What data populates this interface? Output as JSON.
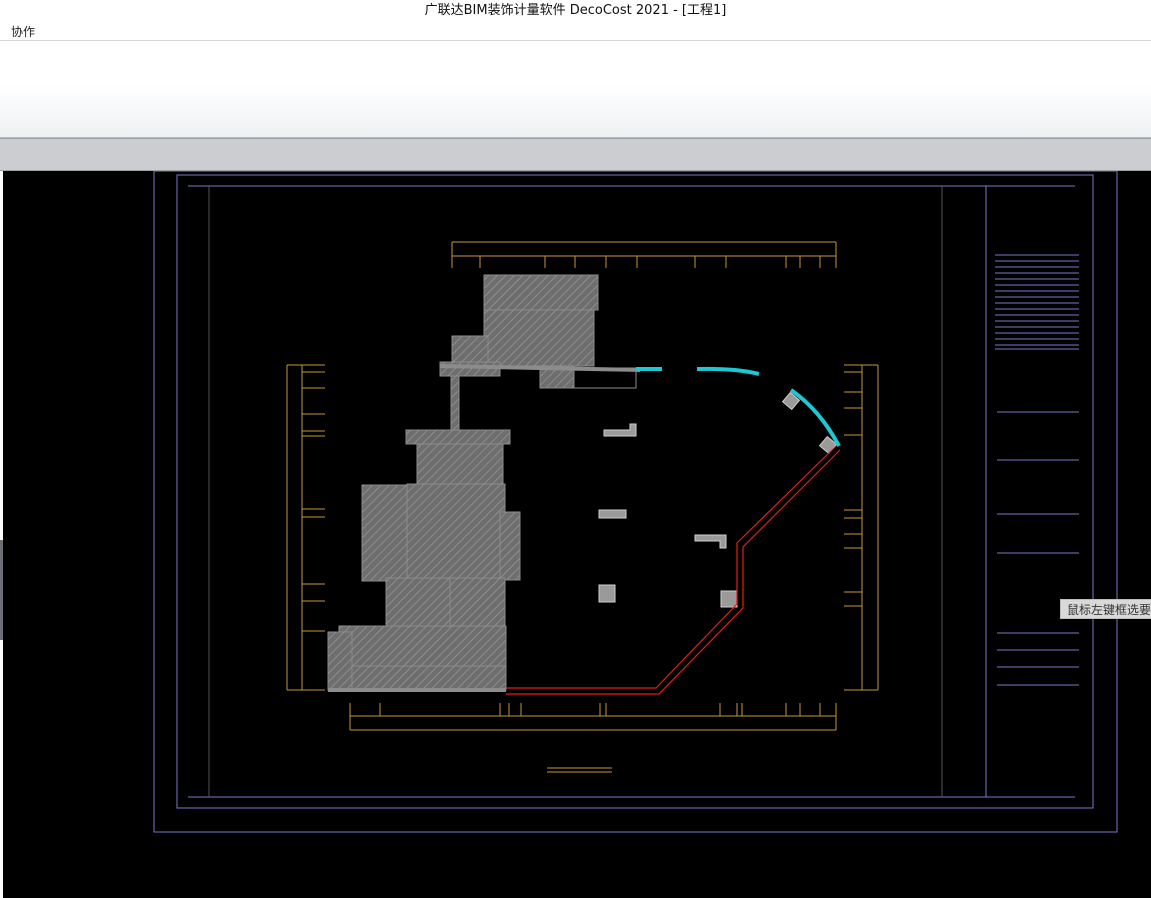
{
  "window": {
    "title": "广联达BIM装饰计量软件 DecoCost 2021 - [工程1]"
  },
  "menubar": {
    "items": [
      {
        "label": "协作"
      }
    ]
  },
  "canvas": {
    "status_hint": "鼠标左键框选要",
    "colors": {
      "background": "#000000",
      "frame": "#7878c8",
      "dimension": "#c8963c",
      "wall": "#808080",
      "curtain_wall": "#1ec8d2",
      "red_wall": "#e01e1e"
    }
  }
}
